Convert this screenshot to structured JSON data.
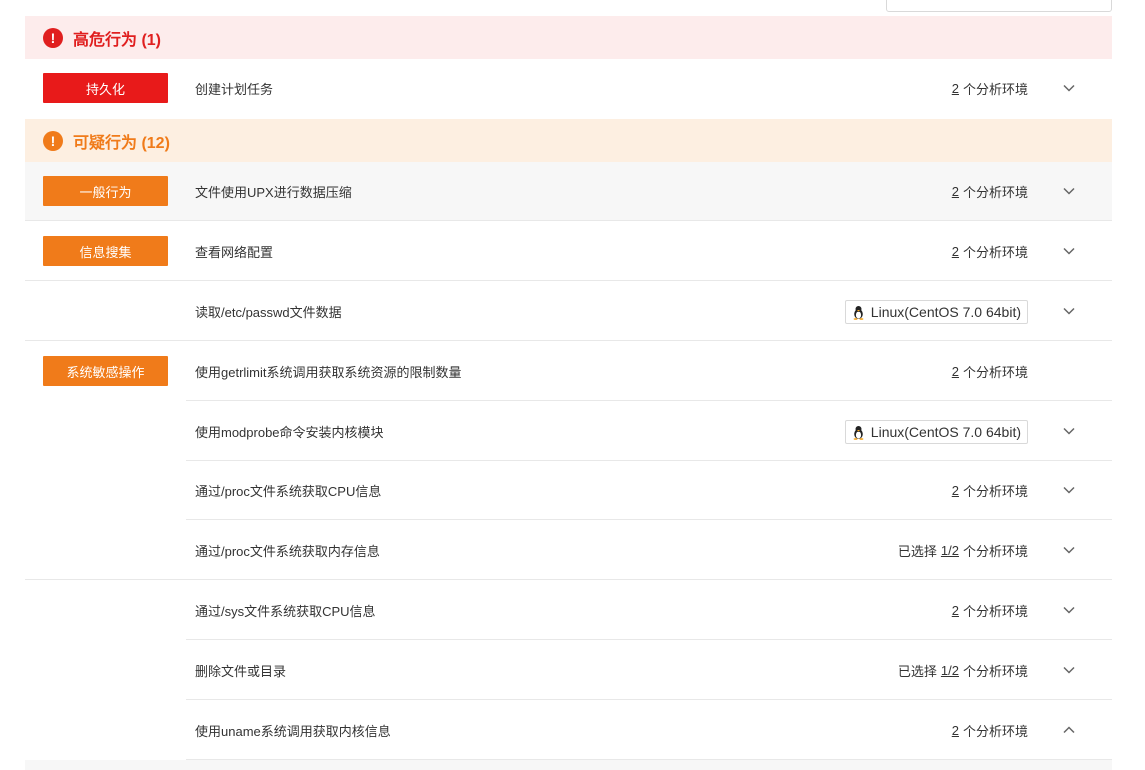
{
  "sections": {
    "high": {
      "title": "高危行为 (1)",
      "icon": "!"
    },
    "suspicious": {
      "title": "可疑行为 (12)",
      "icon": "!"
    }
  },
  "colors": {
    "high": "#e01f1f",
    "suspicious": "#f07b1a"
  },
  "rows": [
    {
      "tag": "持久化",
      "behavior": "创建计划任务",
      "env_prefix": "",
      "env_count": "2",
      "env_suffix": "个分析环境",
      "chevron": "chevron-down-icon"
    },
    {
      "tag": "一般行为",
      "behavior": "文件使用UPX进行数据压缩",
      "env_prefix": "",
      "env_count": "2",
      "env_suffix": "个分析环境",
      "chevron": "chevron-down-icon"
    },
    {
      "tag": "信息搜集",
      "behavior": "查看网络配置",
      "env_prefix": "",
      "env_count": "2",
      "env_suffix": "个分析环境",
      "chevron": "chevron-down-icon"
    },
    {
      "tag": "",
      "behavior": "读取/etc/passwd文件数据",
      "os": "Linux(CentOS 7.0 64bit)",
      "chevron": "chevron-down-icon"
    },
    {
      "tag": "系统敏感操作",
      "behavior": "使用getrlimit系统调用获取系统资源的限制数量",
      "env_prefix": "",
      "env_count": "2",
      "env_suffix": "个分析环境",
      "chevron": ""
    },
    {
      "tag": "",
      "behavior": "使用modprobe命令安装内核模块",
      "os": "Linux(CentOS 7.0 64bit)",
      "chevron": "chevron-down-icon"
    },
    {
      "tag": "",
      "behavior": "通过/proc文件系统获取CPU信息",
      "env_prefix": "",
      "env_count": "2",
      "env_suffix": "个分析环境",
      "chevron": "chevron-down-icon"
    },
    {
      "tag": "",
      "behavior": "通过/proc文件系统获取内存信息",
      "env_prefix": "已选择",
      "env_count": "1/2",
      "env_suffix": "个分析环境",
      "chevron": "chevron-down-icon"
    },
    {
      "tag": "",
      "behavior": "通过/sys文件系统获取CPU信息",
      "env_prefix": "",
      "env_count": "2",
      "env_suffix": "个分析环境",
      "chevron": "chevron-down-icon"
    },
    {
      "tag": "",
      "behavior": "删除文件或目录",
      "env_prefix": "已选择",
      "env_count": "1/2",
      "env_suffix": "个分析环境",
      "chevron": "chevron-down-icon"
    },
    {
      "tag": "",
      "behavior": "使用uname系统调用获取内核信息",
      "env_prefix": "",
      "env_count": "2",
      "env_suffix": "个分析环境",
      "chevron": "chevron-up-icon"
    }
  ]
}
